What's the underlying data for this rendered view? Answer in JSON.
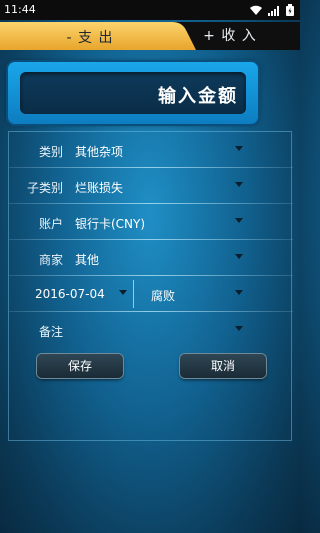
{
  "status_bar": {
    "time": "11:44",
    "icons": [
      "wifi-icon",
      "signal-icon",
      "battery-icon"
    ]
  },
  "tabs": {
    "expense_label": "- 支 出",
    "income_label": "+ 收 入",
    "active": "expense"
  },
  "amount": {
    "placeholder": "输入金额"
  },
  "form": {
    "category": {
      "label": "类别",
      "value": "其他杂项"
    },
    "subcategory": {
      "label": "子类别",
      "value": "烂账损失"
    },
    "account": {
      "label": "账户",
      "value": "银行卡(CNY)"
    },
    "merchant": {
      "label": "商家",
      "value": "其他"
    },
    "date": {
      "value": "2016-07-04"
    },
    "reason": {
      "value": "腐败"
    },
    "note": {
      "label": "备注",
      "value": ""
    }
  },
  "buttons": {
    "save": "保存",
    "cancel": "取消"
  },
  "colors": {
    "tab_active": "#f5c04a",
    "background": "#1a80b8",
    "panel_border": "#5fb6e4"
  }
}
